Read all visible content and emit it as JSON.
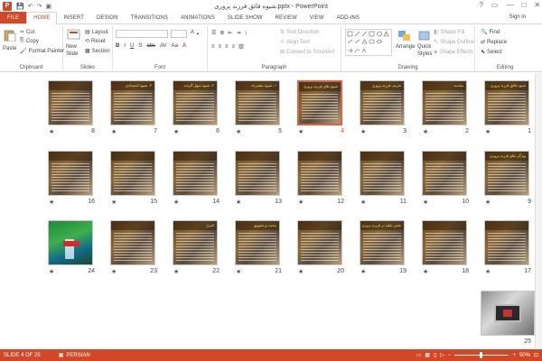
{
  "titlebar": {
    "app_icon_letter": "P",
    "title": "شیوه فائق فرزند پروری.pptx - PowerPoint",
    "qat": [
      "save-icon",
      "undo-icon",
      "redo-icon",
      "present-icon"
    ],
    "controls": [
      "?",
      "▭",
      "—",
      "□",
      "✕"
    ]
  },
  "tabs": [
    "FILE",
    "HOME",
    "INSERT",
    "DESIGN",
    "TRANSITIONS",
    "ANIMATIONS",
    "SLIDE SHOW",
    "REVIEW",
    "VIEW",
    "ADD-INS"
  ],
  "active_tab": "HOME",
  "signin": "Sign in",
  "ribbon": {
    "clipboard": {
      "paste": "Paste",
      "cut": "Cut",
      "copy": "Copy",
      "format_painter": "Format Painter",
      "label": "Clipboard"
    },
    "slides": {
      "new_slide": "New",
      "new_slide_2": "Slide",
      "layout": "Layout",
      "reset": "Reset",
      "section": "Section",
      "label": "Slides"
    },
    "font": {
      "label": "Font",
      "buttons": [
        "B",
        "I",
        "U",
        "S",
        "abc",
        "AV",
        "Aa",
        "A"
      ]
    },
    "paragraph": {
      "label": "Paragraph",
      "text_direction": "Text Direction",
      "align_text": "Align Text",
      "convert_smartart": "Convert to SmartArt"
    },
    "drawing": {
      "arrange": "Arrange",
      "quick_styles": "Quick",
      "quick_styles_2": "Styles",
      "shape_fill": "Shape Fill",
      "shape_outline": "Shape Outline",
      "shape_effects": "Shape Effects",
      "label": "Drawing"
    },
    "editing": {
      "find": "Find",
      "replace": "Replace",
      "select": "Select",
      "label": "Editing"
    }
  },
  "slides": [
    {
      "num": "1",
      "title": "شیوه فائق فرزند پروری"
    },
    {
      "num": "2",
      "title": "مقدمه"
    },
    {
      "num": "3",
      "title": "تعریف فرزند پروری"
    },
    {
      "num": "4",
      "title": "شیوه های فرزند پروری",
      "selected": true
    },
    {
      "num": "5",
      "title": "۱- شیوه مقتدرانه"
    },
    {
      "num": "6",
      "title": "۲- شیوه سهل گیرانه"
    },
    {
      "num": "7",
      "title": "۳- شیوه استبدادی"
    },
    {
      "num": "8",
      "title": ""
    },
    {
      "num": "9",
      "title": "ویژگی های فرزند پروری"
    },
    {
      "num": "10",
      "title": ""
    },
    {
      "num": "11",
      "title": ""
    },
    {
      "num": "12",
      "title": ""
    },
    {
      "num": "13",
      "title": ""
    },
    {
      "num": "14",
      "title": ""
    },
    {
      "num": "15",
      "title": ""
    },
    {
      "num": "16",
      "title": ""
    },
    {
      "num": "17",
      "title": ""
    },
    {
      "num": "18",
      "title": ""
    },
    {
      "num": "19",
      "title": "نقش تقلید در فرزند پروری"
    },
    {
      "num": "20",
      "title": ""
    },
    {
      "num": "21",
      "title": "محبت و تشویق"
    },
    {
      "num": "22",
      "title": "کنترل"
    },
    {
      "num": "23",
      "title": ""
    },
    {
      "num": "24",
      "title": "",
      "variant": "green"
    },
    {
      "num": "25",
      "title": "",
      "variant": "photo"
    }
  ],
  "star": "★",
  "statusbar": {
    "slide_of": "SLIDE 4 OF 25",
    "language": "PERSIAN",
    "zoom": "50%"
  }
}
